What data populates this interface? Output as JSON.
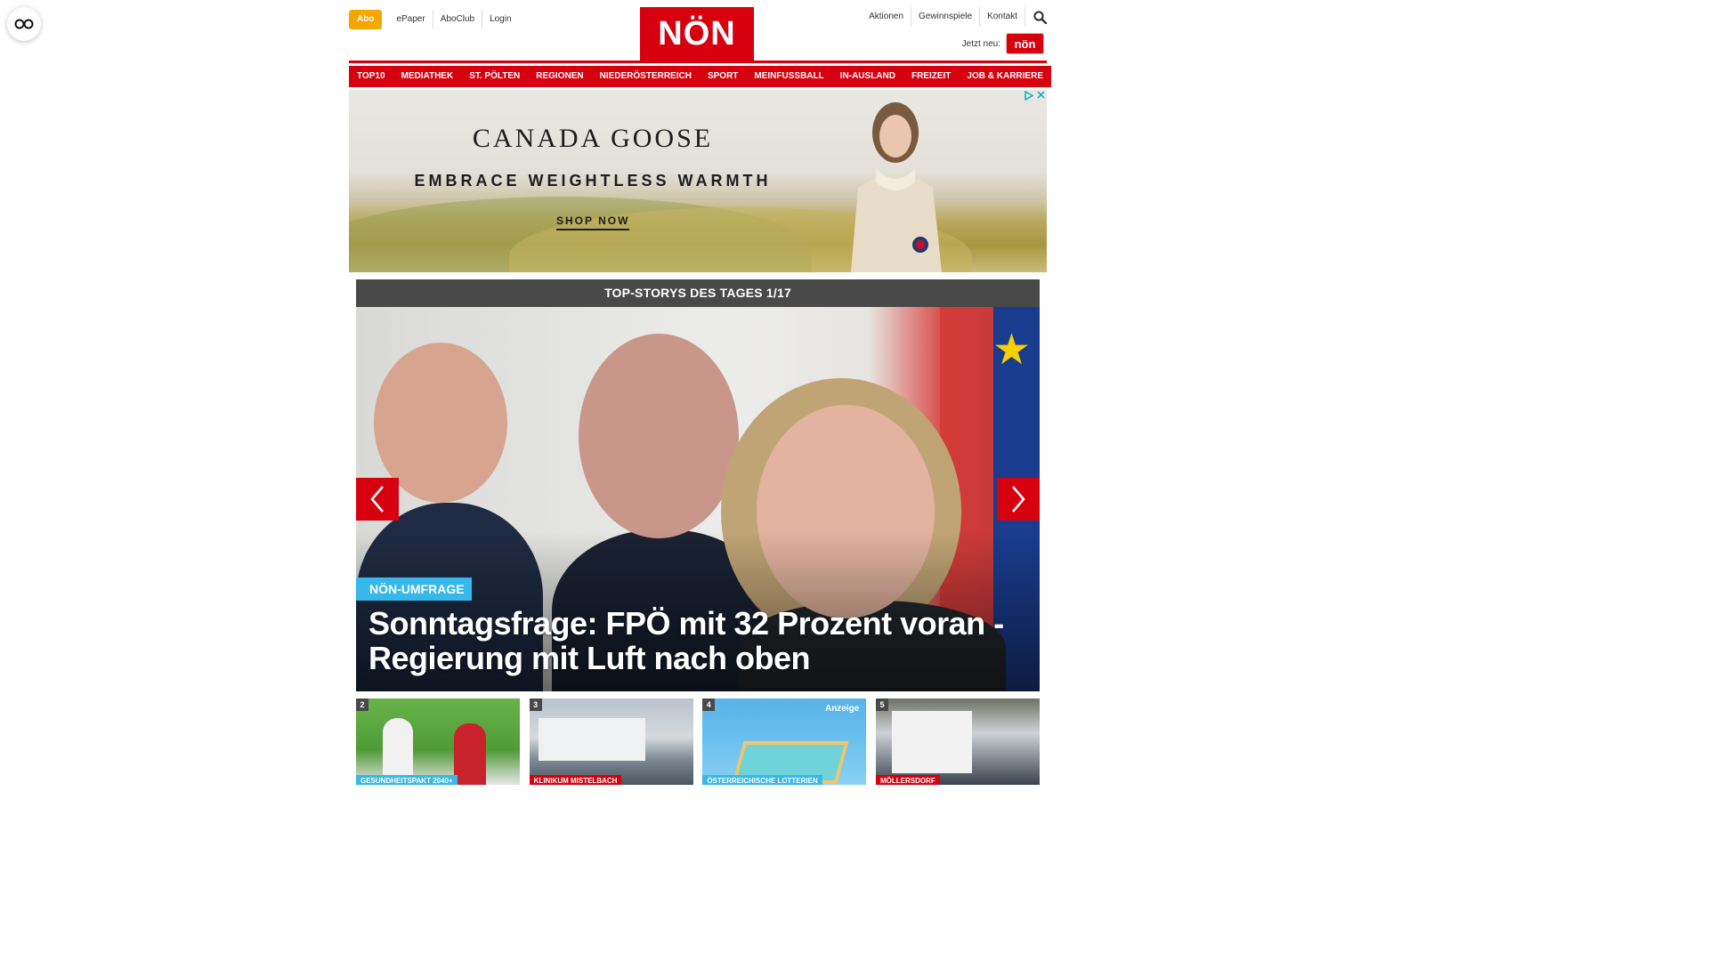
{
  "header": {
    "abo_label": "Abo",
    "top_links": [
      "ePaper",
      "AboClub",
      "Login"
    ],
    "logo_text": "NÖN",
    "right_links": [
      "Aktionen",
      "Gewinnspiele",
      "Kontakt"
    ],
    "search_icon": "search-icon",
    "jetzt_label": "Jetzt neu:",
    "jetzt_badge": "nön"
  },
  "main_nav": [
    "TOP10",
    "MEDIATHEK",
    "ST. PÖLTEN",
    "REGIONEN",
    "NIEDERÖSTERREICH",
    "SPORT",
    "MEINFUSSBALL",
    "IN-AUSLAND",
    "FREIZEIT",
    "JOB & KARRIERE"
  ],
  "ad": {
    "brand": "CANADA GOOSE",
    "tagline": "EMBRACE WEIGHTLESS WARMTH",
    "cta": "SHOP NOW"
  },
  "top_stories": {
    "bar_title": "TOP-STORYS DES TAGES 1/17",
    "hero": {
      "category": "NÖN-UMFRAGE",
      "headline": "Sonntagsfrage: FPÖ mit 32 Prozent voran - Regierung mit Luft nach oben"
    },
    "thumbs": [
      {
        "num": "2",
        "category": "GESUNDHEITSPAKT 2040+",
        "ad": ""
      },
      {
        "num": "3",
        "category": "KLINIKUM MISTELBACH",
        "ad": ""
      },
      {
        "num": "4",
        "category": "ÖSTERREICHISCHE LOTTERIEN",
        "ad": "Anzeige"
      },
      {
        "num": "5",
        "category": "MÖLLERSDORF",
        "ad": ""
      }
    ]
  },
  "colors": {
    "brand_red": "#d7000f",
    "abo_orange": "#f7a600",
    "category_blue": "#36b8ea",
    "bar_gray": "#494949"
  }
}
